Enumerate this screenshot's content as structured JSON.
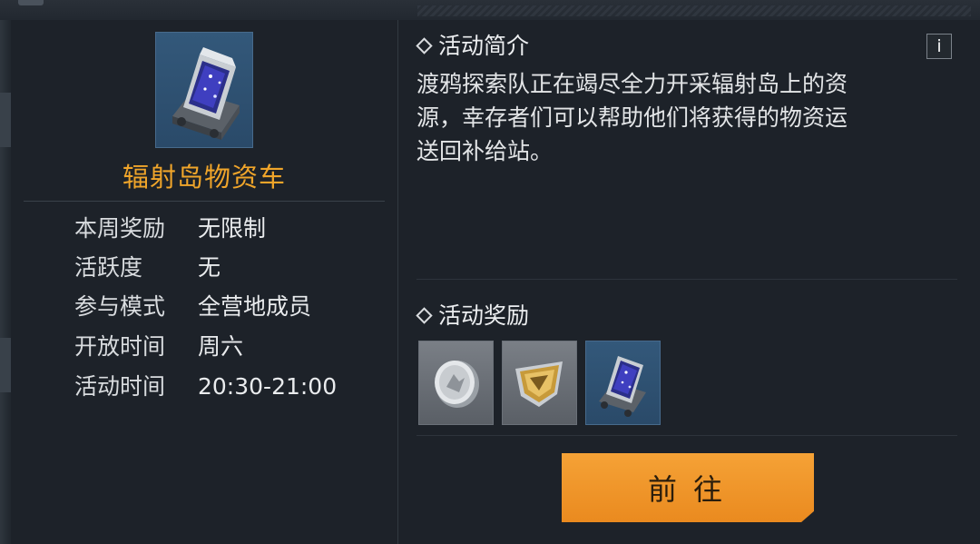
{
  "event": {
    "name": "辐射岛物资车",
    "icon": "supply-truck-icon"
  },
  "info": [
    {
      "label": "本周奖励",
      "value": "无限制"
    },
    {
      "label": "活跃度",
      "value": "无"
    },
    {
      "label": "参与模式",
      "value": "全营地成员"
    },
    {
      "label": "开放时间",
      "value": "周六"
    },
    {
      "label": "活动时间",
      "value": "20:30-21:00"
    }
  ],
  "intro": {
    "title": "活动简介",
    "info_button": "i",
    "lines": [
      "渡鸦探索队正在竭尽全力开采辐射岛上的资",
      "源，幸存者们可以帮助他们将获得的物资运",
      "送回补给站。"
    ]
  },
  "rewards": {
    "title": "活动奖励",
    "items": [
      {
        "icon": "silver-coin-icon"
      },
      {
        "icon": "gold-badge-icon"
      },
      {
        "icon": "supply-truck-icon"
      }
    ]
  },
  "go_button": "前往",
  "colors": {
    "accent_orange": "#f0a52a",
    "button_orange": "#f0962c",
    "panel_bg": "#1d2229",
    "icon_blue": "#2f5275"
  }
}
